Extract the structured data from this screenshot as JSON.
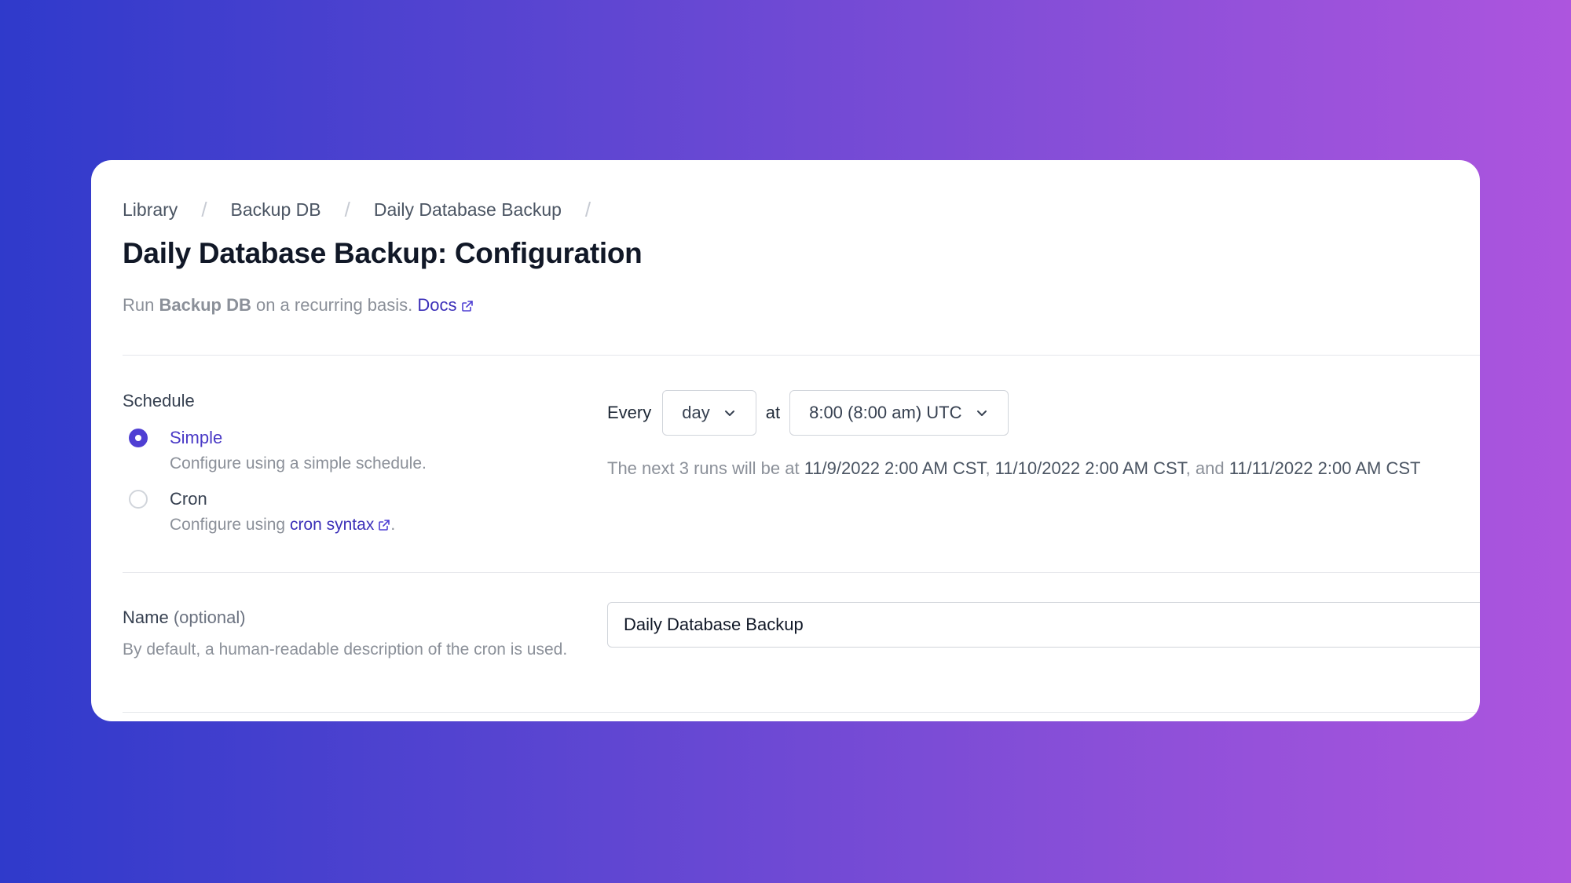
{
  "breadcrumb": {
    "items": [
      "Library",
      "Backup DB",
      "Daily Database Backup"
    ],
    "separator": "/"
  },
  "page": {
    "title": "Daily Database Backup: Configuration",
    "subtitle_prefix": "Run ",
    "subtitle_job": "Backup DB",
    "subtitle_suffix": " on a recurring basis. ",
    "docs_link": "Docs"
  },
  "schedule": {
    "label": "Schedule",
    "options": [
      {
        "title": "Simple",
        "desc": "Configure using a simple schedule.",
        "selected": true
      },
      {
        "title": "Cron",
        "desc_prefix": "Configure using ",
        "desc_link": "cron syntax",
        "desc_suffix": ".",
        "selected": false
      }
    ],
    "every_label": "Every",
    "frequency": "day",
    "at_label": "at",
    "time": "8:00 (8:00 am) UTC",
    "next_runs_prefix": "The next 3 runs will be at ",
    "run1": "11/9/2022 2:00 AM CST",
    "sep1": ", ",
    "run2": "11/10/2022 2:00 AM CST",
    "sep2": ", and ",
    "run3": "11/11/2022 2:00 AM CST"
  },
  "name": {
    "label": "Name",
    "optional": "(optional)",
    "desc": "By default, a human-readable description of the cron is used.",
    "value": "Daily Database Backup"
  },
  "colors": {
    "accent": "#4f3fd3",
    "link": "#3b2fb8",
    "background_start": "#2f3acb",
    "background_end": "#ad55de"
  },
  "icons": [
    "external-link-icon",
    "chevron-down-icon",
    "radio-checked-icon",
    "radio-unchecked-icon"
  ]
}
